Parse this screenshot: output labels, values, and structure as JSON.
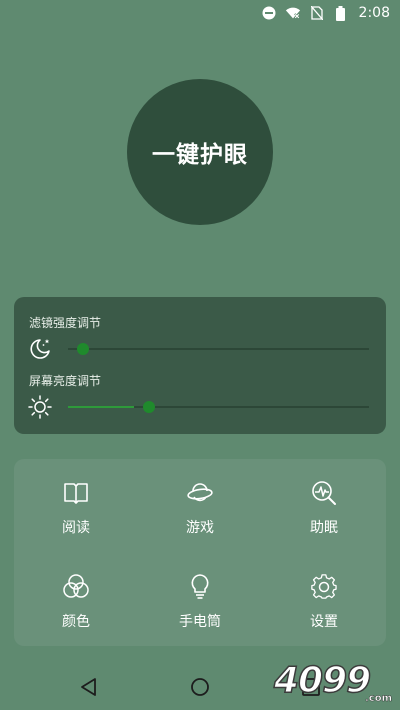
{
  "status_bar": {
    "time": "2:08",
    "icons": [
      "do-not-disturb-icon",
      "wifi-off-icon",
      "no-sim-icon",
      "battery-icon"
    ]
  },
  "main_button": {
    "label": "一键护眼"
  },
  "sliders": [
    {
      "label": "滤镜强度调节",
      "icon": "moon-stars-icon",
      "value": 0.0
    },
    {
      "label": "屏幕亮度调节",
      "icon": "sun-icon",
      "value": 0.22
    }
  ],
  "grid": [
    {
      "label": "阅读",
      "icon": "book-icon"
    },
    {
      "label": "游戏",
      "icon": "planet-icon"
    },
    {
      "label": "助眠",
      "icon": "sleep-search-icon"
    },
    {
      "label": "颜色",
      "icon": "color-circles-icon"
    },
    {
      "label": "手电筒",
      "icon": "bulb-icon"
    },
    {
      "label": "设置",
      "icon": "gear-icon"
    }
  ],
  "nav": [
    "back-icon",
    "home-icon",
    "recents-icon"
  ],
  "watermark": {
    "text": "4099",
    "sub": ".com"
  },
  "colors": {
    "background": "#5f8a70",
    "button": "#2f4e3c",
    "slider_panel": "#3b5a48",
    "grid_panel": "#6a917a",
    "accent": "#2e9a3a"
  }
}
